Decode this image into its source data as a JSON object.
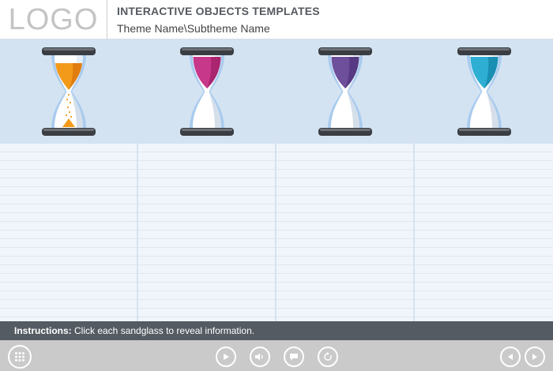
{
  "header": {
    "logo": "LOGO",
    "title": "INTERACTIVE OBJECTS TEMPLATES",
    "subtitle": "Theme Name\\Subtheme Name"
  },
  "sandglasses": [
    {
      "name": "orange",
      "color": "#f39a1b",
      "shade": "#e07d0e",
      "state": "running"
    },
    {
      "name": "pink",
      "color": "#c7378a",
      "shade": "#a92570",
      "state": "idle"
    },
    {
      "name": "purple",
      "color": "#6d4f9c",
      "shade": "#563a83",
      "state": "idle"
    },
    {
      "name": "blue",
      "color": "#2eaed3",
      "shade": "#1b8fb3",
      "state": "idle"
    }
  ],
  "instructions": {
    "label": "Instructions:",
    "text": " Click each sandglass to reveal information."
  },
  "controls": {
    "menu": "grid-icon",
    "play": "play-icon",
    "audio": "speaker-icon",
    "captions": "caption-icon",
    "replay": "replay-icon",
    "prev": "prev-icon",
    "next": "next-icon"
  }
}
